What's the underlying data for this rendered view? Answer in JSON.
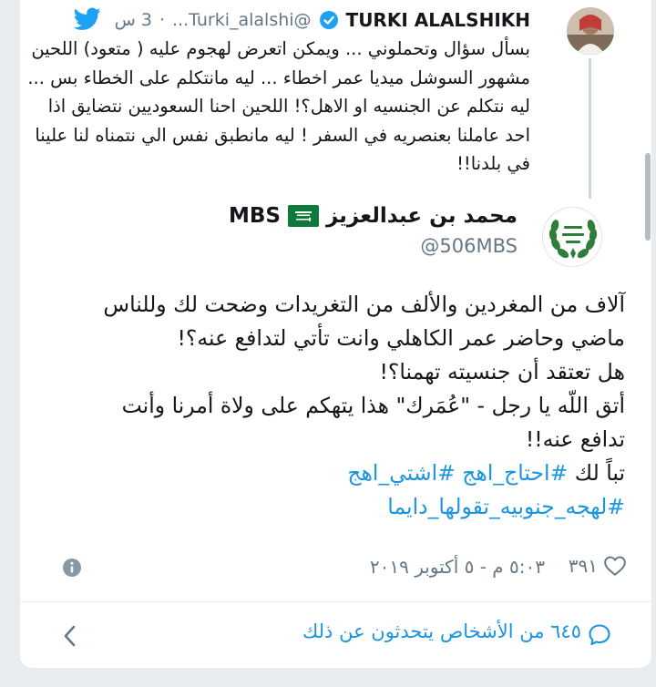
{
  "parent_tweet": {
    "display_name": "TURKI ALALSHIKH",
    "handle": "@Turki_alalshi...",
    "separator": "·",
    "time": "3 س",
    "text": "بسأل سؤال وتحملوني ... ويمكن اتعرض لهجوم عليه ( متعود) اللحين مشهور السوشل ميديا عمر اخطاء ... ليه مانتكلم على الخطاء بس ... ليه نتكلم عن الجنسيه او الاهل؟! اللحين احنا السعوديين نتضايق اذا احد عاملنا بعنصريه في السفر ! ليه مانطبق نفس الي نتمناه لنا علينا في بلدنا!!"
  },
  "main_tweet": {
    "name_arabic": "محمد بن عبدالعزيز",
    "name_latin": "MBS",
    "handle": "@506MBS",
    "lines": [
      "آلاف من المغردين والألف من التغريدات وضحت لك وللناس",
      "ماضي وحاضر عمر الكاهلي وانت تأتي لتدافع عنه؟!",
      "هل تعتقد أن جنسيته تهمنا؟!",
      "أتق اللّه يا رجل - \"عُمَرك\" هذا يتهكم على ولاة أمرنا وأنت",
      "تدافع عنه!!"
    ],
    "hashtag_line_prefix": "تباً لك",
    "hashtags_line1": "#احتاج_اهج #اشتي_اهج",
    "hashtags_line2": "#لهجه_جنوبيه_تقولها_دايما",
    "timestamp": "٥:٠٣ م - ٥ أكتوبر ٢٠١٩",
    "likes": "٣٩١"
  },
  "people_talking": "٦٤٥ من الأشخاص يتحدثون عن ذلك",
  "icons": {
    "verified": "verified-badge-icon",
    "bird": "twitter-bird-icon",
    "info": "info-icon",
    "heart": "heart-icon",
    "bubble": "speech-bubble-icon",
    "chevron": "chevron-left-icon",
    "flag": "saudi-flag-icon"
  },
  "colors": {
    "accent": "#1b95e0",
    "secondary_text": "#657786",
    "flag_green": "#0d7a3a"
  }
}
